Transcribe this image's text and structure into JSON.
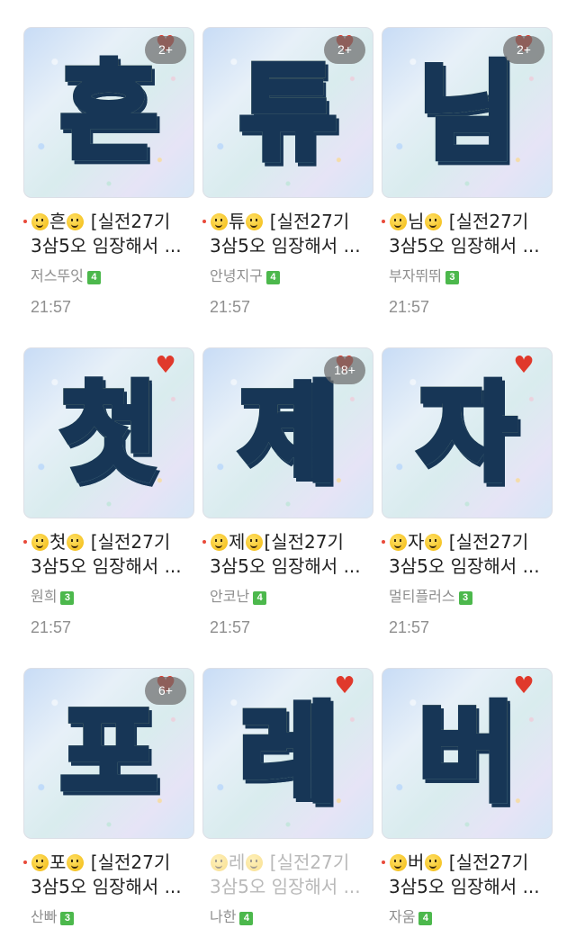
{
  "colors": {
    "heart": "#e0392b",
    "level_badge": "#4cb84c",
    "unread_dot": "#e94a3a"
  },
  "posts": [
    {
      "char": "흔",
      "title_char": "흔",
      "title_rest": "[실전27기",
      "line2": "3삼5오 임장해서 ...",
      "author": "저스뚜잇",
      "level": "4",
      "time": "21:57",
      "badge": "2+"
    },
    {
      "char": "튜",
      "title_char": "튜",
      "title_rest": "[실전27기",
      "line2": "3삼5오 임장해서 ...",
      "author": "안녕지구",
      "level": "4",
      "time": "21:57",
      "badge": "2+"
    },
    {
      "char": "님",
      "title_char": "님",
      "title_rest": "[실전27기",
      "line2": "3삼5오 임장해서 ...",
      "author": "부자뛰뛰",
      "level": "3",
      "time": "21:57",
      "badge": "2+"
    },
    {
      "char": "첫",
      "title_char": "첫",
      "title_rest": "[실전27기",
      "line2": "3삼5오 임장해서 ...",
      "author": "원희",
      "level": "3",
      "time": "21:57",
      "badge": ""
    },
    {
      "char": "제",
      "title_char": "제",
      "title_rest": "[실전27기",
      "line2": "3삼5오 임장해서 ...",
      "author": "안코난",
      "level": "4",
      "time": "21:57",
      "badge": "18+"
    },
    {
      "char": "자",
      "title_char": "자",
      "title_rest": "[실전27기",
      "line2": "3삼5오 임장해서 ...",
      "author": "멀티플러스",
      "level": "3",
      "time": "21:57",
      "badge": ""
    },
    {
      "char": "포",
      "title_char": "포",
      "title_rest": "[실전27기",
      "line2": "3삼5오 임장해서 ...",
      "author": "산빠",
      "level": "3",
      "time": "",
      "badge": "6+"
    },
    {
      "char": "레",
      "title_char": "레",
      "title_rest": "[실전27기",
      "line2": "3삼5오 임장해서 ...",
      "author": "나한",
      "level": "4",
      "time": "",
      "badge": ""
    },
    {
      "char": "버",
      "title_char": "버",
      "title_rest": "[실전27기",
      "line2": "3삼5오 임장해서 ...",
      "author": "자움",
      "level": "4",
      "time": "",
      "badge": ""
    }
  ]
}
